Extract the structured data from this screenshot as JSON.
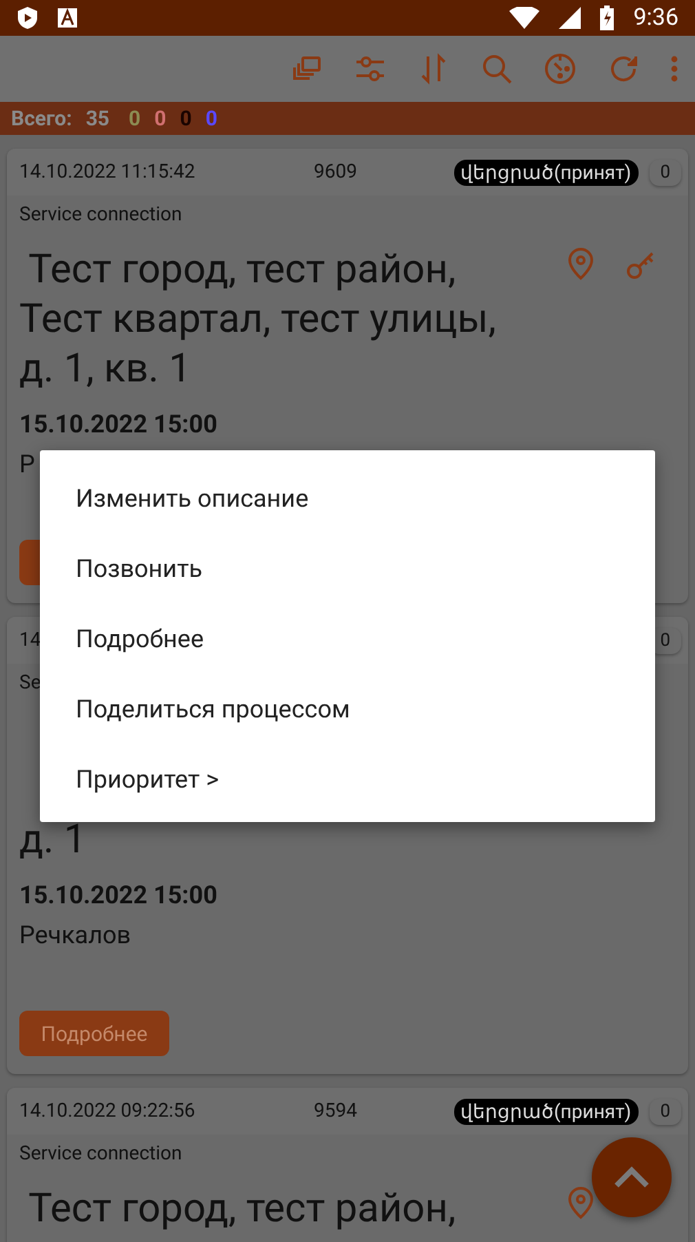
{
  "status_bar": {
    "time": "9:36"
  },
  "summary": {
    "label": "Всего:",
    "total": "35",
    "counts": [
      {
        "value": "0",
        "color": "#8c8c52"
      },
      {
        "value": "0",
        "color": "#d07070"
      },
      {
        "value": "0",
        "color": "#1a0400"
      },
      {
        "value": "0",
        "color": "#5a48ff"
      }
    ]
  },
  "cards": [
    {
      "created": "14.10.2022 11:15:42",
      "number": "9609",
      "status": "վերցրած(принят)",
      "comments": "0",
      "type": "Service connection",
      "address_lines": [
        " Тест город, тест район,",
        "Тест квартал, тест улицы,",
        "д. 1, кв. 1"
      ],
      "actions": [
        {
          "kind": "location"
        },
        {
          "kind": "key"
        }
      ],
      "due": "15.10.2022 15:00",
      "person": "Р",
      "button": true
    },
    {
      "created": "14",
      "comments": "0",
      "type": "Se",
      "address_covered": true,
      "address_lines": [
        "д. 1"
      ],
      "due": "15.10.2022 15:00",
      "person": "Речкалов",
      "button": "Подробнее"
    },
    {
      "created": "14.10.2022 09:22:56",
      "number": "9594",
      "status": "վերցրած(принят)",
      "comments": "0",
      "type": "Service connection",
      "address_lines": [
        " Тест город, тест район,"
      ],
      "actions": [
        {
          "kind": "location"
        }
      ]
    }
  ],
  "context_menu": {
    "items": [
      "Изменить описание",
      "Позвонить",
      "Подробнее",
      "Поделиться процессом",
      "Приоритет >"
    ]
  }
}
